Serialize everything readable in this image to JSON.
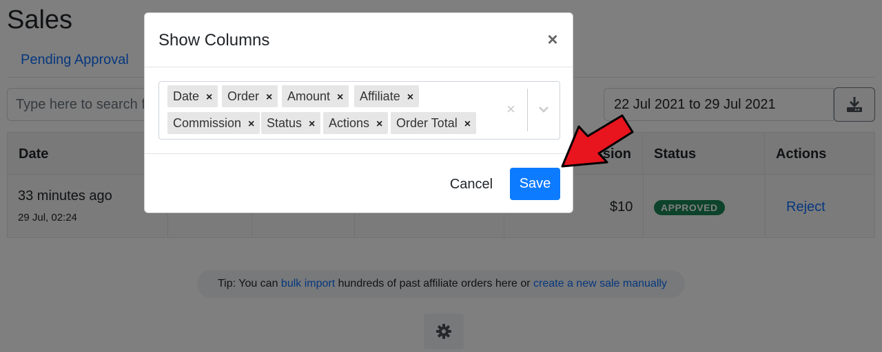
{
  "page": {
    "title": "Sales",
    "tab_pending": "Pending Approval",
    "search_placeholder": "Type here to search fo",
    "date_range": "22 Jul 2021 to 29 Jul 2021",
    "table_headers": {
      "date": "Date",
      "commission": "ssion",
      "status": "Status",
      "actions": "Actions"
    },
    "row": {
      "time_ago": "33 minutes ago",
      "date": "29 Jul, 02:24",
      "commission": "$10",
      "status": "APPROVED",
      "action": "Reject"
    },
    "tip": {
      "prefix": "Tip: You can ",
      "link1": "bulk import",
      "middle": " hundreds of past affiliate orders here or ",
      "link2": "create a new sale manually"
    },
    "colors": {
      "status_approved": "#198754",
      "link": "#0d6efd"
    },
    "icons": {
      "download": "download-icon",
      "settings": "gear-icon"
    }
  },
  "modal": {
    "title": "Show Columns",
    "close_glyph": "×",
    "chips": [
      {
        "label": "Date"
      },
      {
        "label": "Order"
      },
      {
        "label": "Amount"
      },
      {
        "label": "Affiliate"
      },
      {
        "label": "Commission"
      },
      {
        "label": "Status"
      },
      {
        "label": "Actions"
      },
      {
        "label": "Order Total"
      }
    ],
    "chip_remove_glyph": "×",
    "clear_glyph": "×",
    "cancel_label": "Cancel",
    "save_label": "Save",
    "colors": {
      "primary": "#0d7bff",
      "annotation_arrow": "#e8141e"
    }
  }
}
